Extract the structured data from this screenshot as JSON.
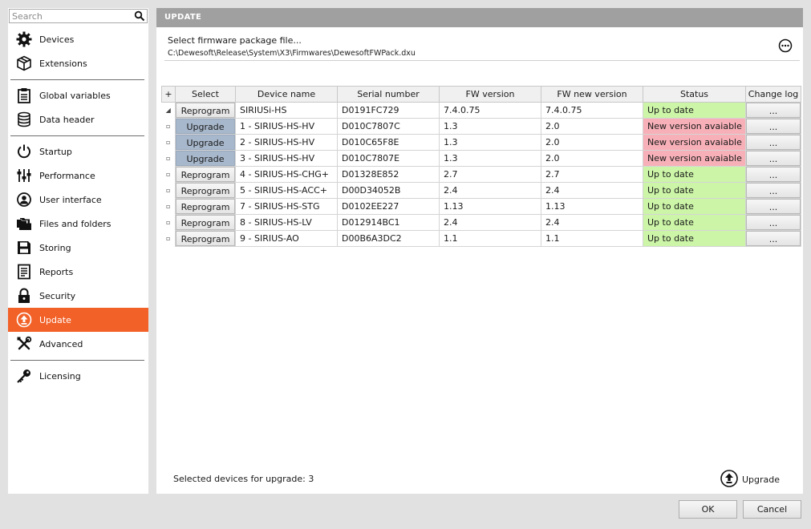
{
  "search": {
    "placeholder": "Search"
  },
  "sidebar": {
    "items": [
      {
        "label": "Devices",
        "icon": "gear-icon"
      },
      {
        "label": "Extensions",
        "icon": "cube-icon"
      },
      {
        "label": "Global variables",
        "icon": "clipboard-icon"
      },
      {
        "label": "Data header",
        "icon": "database-icon"
      },
      {
        "label": "Startup",
        "icon": "power-icon"
      },
      {
        "label": "Performance",
        "icon": "sliders-icon"
      },
      {
        "label": "User interface",
        "icon": "user-icon"
      },
      {
        "label": "Files and folders",
        "icon": "folders-icon"
      },
      {
        "label": "Storing",
        "icon": "floppy-icon"
      },
      {
        "label": "Reports",
        "icon": "report-icon"
      },
      {
        "label": "Security",
        "icon": "lock-icon"
      },
      {
        "label": "Update",
        "icon": "upload-icon",
        "active": true
      },
      {
        "label": "Advanced",
        "icon": "tools-icon"
      },
      {
        "label": "Licensing",
        "icon": "key-icon"
      }
    ]
  },
  "header": {
    "title": "UPDATE"
  },
  "package": {
    "label": "Select firmware package file...",
    "path": "C:\\Dewesoft\\Release\\System\\X3\\Firmwares\\DewesoftFWPack.dxu",
    "more_label": "..."
  },
  "table": {
    "columns": [
      "+",
      "Select",
      "Device name",
      "Serial number",
      "FW version",
      "FW new version",
      "Status",
      "Change log"
    ],
    "rows": [
      {
        "expander": "◢",
        "select": "Reprogram",
        "device": "SIRIUSi-HS",
        "serial": "D0191FC729",
        "fw": "7.4.0.75",
        "fw_new": "7.4.0.75",
        "status": "Up to date",
        "status_type": "ok",
        "log": "..."
      },
      {
        "expander": "▫",
        "select": "Upgrade",
        "device": "1 - SIRIUS-HS-HV",
        "serial": "D010C7807C",
        "fw": "1.3",
        "fw_new": "2.0",
        "status": "New version avaiable",
        "status_type": "new",
        "log": "..."
      },
      {
        "expander": "▫",
        "select": "Upgrade",
        "device": "2 - SIRIUS-HS-HV",
        "serial": "D010C65F8E",
        "fw": "1.3",
        "fw_new": "2.0",
        "status": "New version avaiable",
        "status_type": "new",
        "log": "..."
      },
      {
        "expander": "▫",
        "select": "Upgrade",
        "device": "3 - SIRIUS-HS-HV",
        "serial": "D010C7807E",
        "fw": "1.3",
        "fw_new": "2.0",
        "status": "New version avaiable",
        "status_type": "new",
        "log": "..."
      },
      {
        "expander": "▫",
        "select": "Reprogram",
        "device": "4 - SIRIUS-HS-CHG+",
        "serial": "D01328E852",
        "fw": "2.7",
        "fw_new": "2.7",
        "status": "Up to date",
        "status_type": "ok",
        "log": "..."
      },
      {
        "expander": "▫",
        "select": "Reprogram",
        "device": "5 - SIRIUS-HS-ACC+",
        "serial": "D00D34052B",
        "fw": "2.4",
        "fw_new": "2.4",
        "status": "Up to date",
        "status_type": "ok",
        "log": "..."
      },
      {
        "expander": "▫",
        "select": "Reprogram",
        "device": "7 - SIRIUS-HS-STG",
        "serial": "D0102EE227",
        "fw": "1.13",
        "fw_new": "1.13",
        "status": "Up to date",
        "status_type": "ok",
        "log": "..."
      },
      {
        "expander": "▫",
        "select": "Reprogram",
        "device": "8 - SIRIUS-HS-LV",
        "serial": "D012914BC1",
        "fw": "2.4",
        "fw_new": "2.4",
        "status": "Up to date",
        "status_type": "ok",
        "log": "..."
      },
      {
        "expander": "▫",
        "select": "Reprogram",
        "device": "9 - SIRIUS-AO",
        "serial": "D00B6A3DC2",
        "fw": "1.1",
        "fw_new": "1.1",
        "status": "Up to date",
        "status_type": "ok",
        "log": "..."
      }
    ]
  },
  "footer": {
    "selected_text": "Selected devices for upgrade: 3",
    "upgrade_label": "Upgrade"
  },
  "dialog": {
    "ok_label": "OK",
    "cancel_label": "Cancel"
  },
  "colors": {
    "accent": "#f26128",
    "up_to_date": "#ccf5a8",
    "new_version": "#f7b0b8",
    "upgrade_button": "#a8b8cc",
    "header_bar": "#a0a0a0"
  }
}
